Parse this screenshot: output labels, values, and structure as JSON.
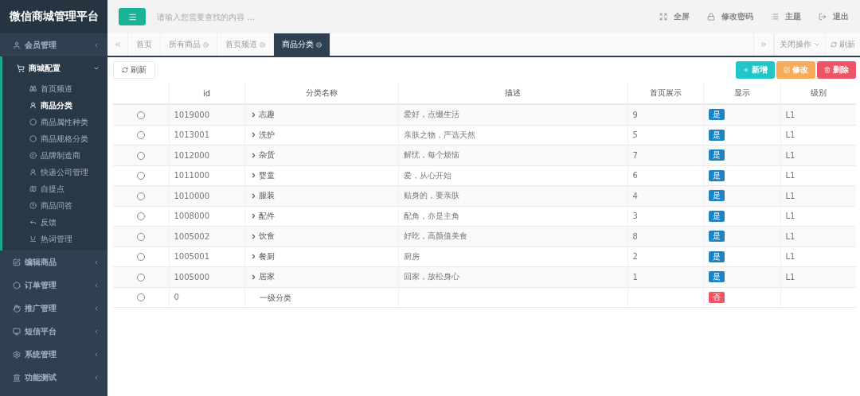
{
  "app_title": "微信商城管理平台",
  "sidebar": [
    {
      "label": "会员管理",
      "expanded": false
    },
    {
      "label": "商城配置",
      "expanded": true,
      "children": [
        {
          "label": "首页频道",
          "selected": false
        },
        {
          "label": "商品分类",
          "selected": true
        },
        {
          "label": "商品属性种类",
          "selected": false
        },
        {
          "label": "商品规格分类",
          "selected": false
        },
        {
          "label": "品牌制造商",
          "selected": false
        },
        {
          "label": "快递公司管理",
          "selected": false
        },
        {
          "label": "自提点",
          "selected": false
        },
        {
          "label": "商品问答",
          "selected": false
        },
        {
          "label": "反馈",
          "selected": false
        },
        {
          "label": "热词管理",
          "selected": false
        }
      ]
    },
    {
      "label": "编辑商品",
      "expanded": false
    },
    {
      "label": "订单管理",
      "expanded": false
    },
    {
      "label": "推广管理",
      "expanded": false
    },
    {
      "label": "短信平台",
      "expanded": false
    },
    {
      "label": "系统管理",
      "expanded": false
    },
    {
      "label": "功能测试",
      "expanded": false
    }
  ],
  "search": {
    "placeholder": "请输入您需要查找的内容 …"
  },
  "top_actions": [
    {
      "label": "全屏"
    },
    {
      "label": "修改密码"
    },
    {
      "label": "主题"
    },
    {
      "label": "退出"
    }
  ],
  "tabs": [
    {
      "label": "首页",
      "closable": false,
      "selected": false
    },
    {
      "label": "所有商品",
      "closable": true,
      "selected": false
    },
    {
      "label": "首页频道",
      "closable": true,
      "selected": false
    },
    {
      "label": "商品分类",
      "closable": true,
      "selected": true
    }
  ],
  "tab_tools": {
    "close_ops": "关闭操作",
    "refresh": "刷新"
  },
  "toolbar": {
    "refresh": "刷新",
    "buttons": [
      {
        "label": "新增",
        "kind": "add"
      },
      {
        "label": "修改",
        "kind": "edit"
      },
      {
        "label": "删除",
        "kind": "delete"
      }
    ]
  },
  "table": {
    "columns": [
      "id",
      "分类名称",
      "描述",
      "首页展示",
      "显示",
      "级别"
    ],
    "rows": [
      {
        "selected": false,
        "id": "1019000",
        "name": "志趣",
        "has_children": true,
        "desc": "爱好，点缀生活",
        "home": "9",
        "shown": true,
        "show_label": "是",
        "level_text": "L1"
      },
      {
        "selected": false,
        "id": "1013001",
        "name": "洗护",
        "has_children": true,
        "desc": "亲肤之物，严选天然",
        "home": "5",
        "shown": true,
        "show_label": "是",
        "level_text": "L1"
      },
      {
        "selected": false,
        "id": "1012000",
        "name": "杂货",
        "has_children": true,
        "desc": "解忧，每个烦恼",
        "home": "7",
        "shown": true,
        "show_label": "是",
        "level_text": "L1"
      },
      {
        "selected": false,
        "id": "1011000",
        "name": "婴童",
        "has_children": true,
        "desc": "爱，从心开始",
        "home": "6",
        "shown": true,
        "show_label": "是",
        "level_text": "L1"
      },
      {
        "selected": false,
        "id": "1010000",
        "name": "服装",
        "has_children": true,
        "desc": "贴身的，要亲肤",
        "home": "4",
        "shown": true,
        "show_label": "是",
        "level_text": "L1"
      },
      {
        "selected": false,
        "id": "1008000",
        "name": "配件",
        "has_children": true,
        "desc": "配角，亦是主角",
        "home": "3",
        "shown": true,
        "show_label": "是",
        "level_text": "L1"
      },
      {
        "selected": false,
        "id": "1005002",
        "name": "饮食",
        "has_children": true,
        "desc": "好吃，高颜值美食",
        "home": "8",
        "shown": true,
        "show_label": "是",
        "level_text": "L1"
      },
      {
        "selected": false,
        "id": "1005001",
        "name": "餐厨",
        "has_children": true,
        "desc": "厨房",
        "home": "2",
        "shown": true,
        "show_label": "是",
        "level_text": "L1"
      },
      {
        "selected": false,
        "id": "1005000",
        "name": "居家",
        "has_children": true,
        "desc": "回家，放松身心",
        "home": "1",
        "shown": true,
        "show_label": "是",
        "level_text": "L1"
      },
      {
        "selected": false,
        "id": "0",
        "name": "一级分类",
        "has_children": false,
        "shown": false,
        "show_label": "否"
      }
    ]
  }
}
